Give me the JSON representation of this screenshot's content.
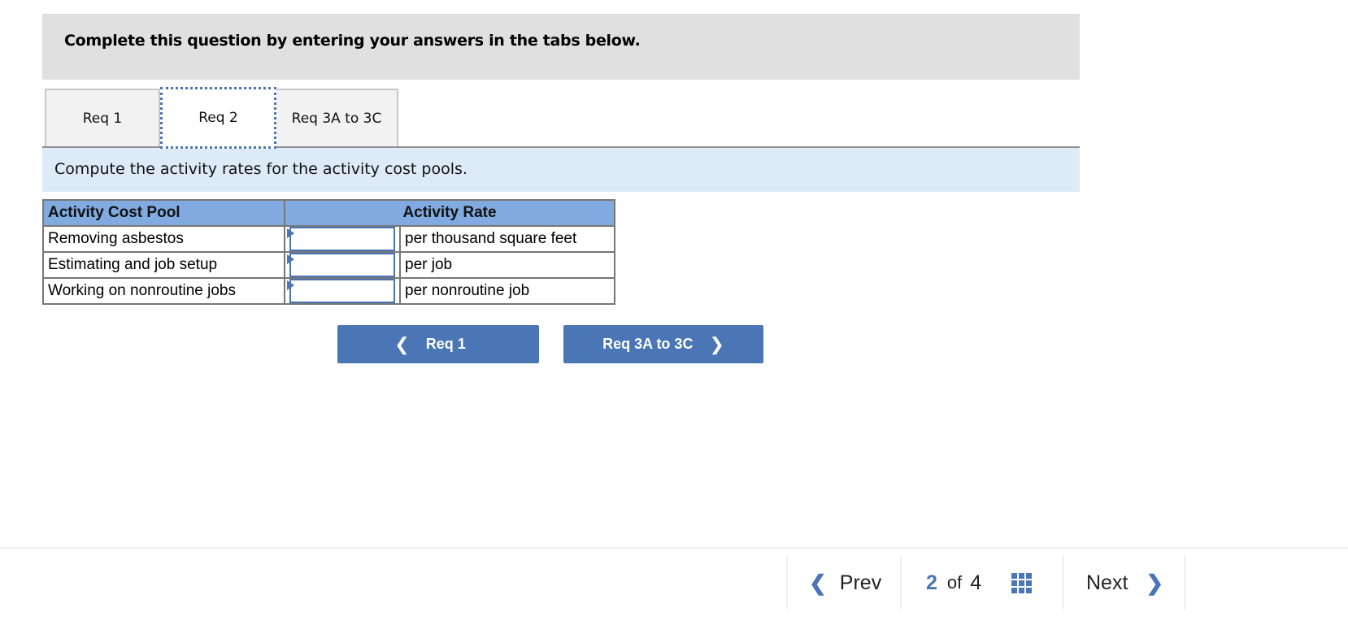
{
  "instructions": "Complete this question by entering your answers in the tabs below.",
  "tabs": [
    {
      "label": "Req 1",
      "active": false
    },
    {
      "label": "Req 2",
      "active": true
    },
    {
      "label": "Req 3A to 3C",
      "active": false
    }
  ],
  "prompt": "Compute the activity rates for the activity cost pools.",
  "table": {
    "headers": [
      "Activity Cost Pool",
      "Activity Rate"
    ],
    "rows": [
      {
        "pool": "Removing asbestos",
        "rate_value": "",
        "unit": "per thousand square feet"
      },
      {
        "pool": "Estimating and job setup",
        "rate_value": "",
        "unit": "per job"
      },
      {
        "pool": "Working on nonroutine jobs",
        "rate_value": "",
        "unit": "per nonroutine job"
      }
    ]
  },
  "nav_buttons": {
    "prev_label": "Req 1",
    "next_label": "Req 3A to 3C",
    "prev_icon": "chevron-left-icon",
    "next_icon": "chevron-right-icon"
  },
  "footer": {
    "prev_label": "Prev",
    "next_label": "Next",
    "current_page": "2",
    "of_label": "of",
    "total_pages": "4",
    "grid_icon": "grid-icon"
  },
  "colors": {
    "accent": "#4a76b5",
    "header_bg": "#80aae0",
    "prompt_bg": "#ddebf8",
    "instruction_bg": "#e0e0e0"
  }
}
